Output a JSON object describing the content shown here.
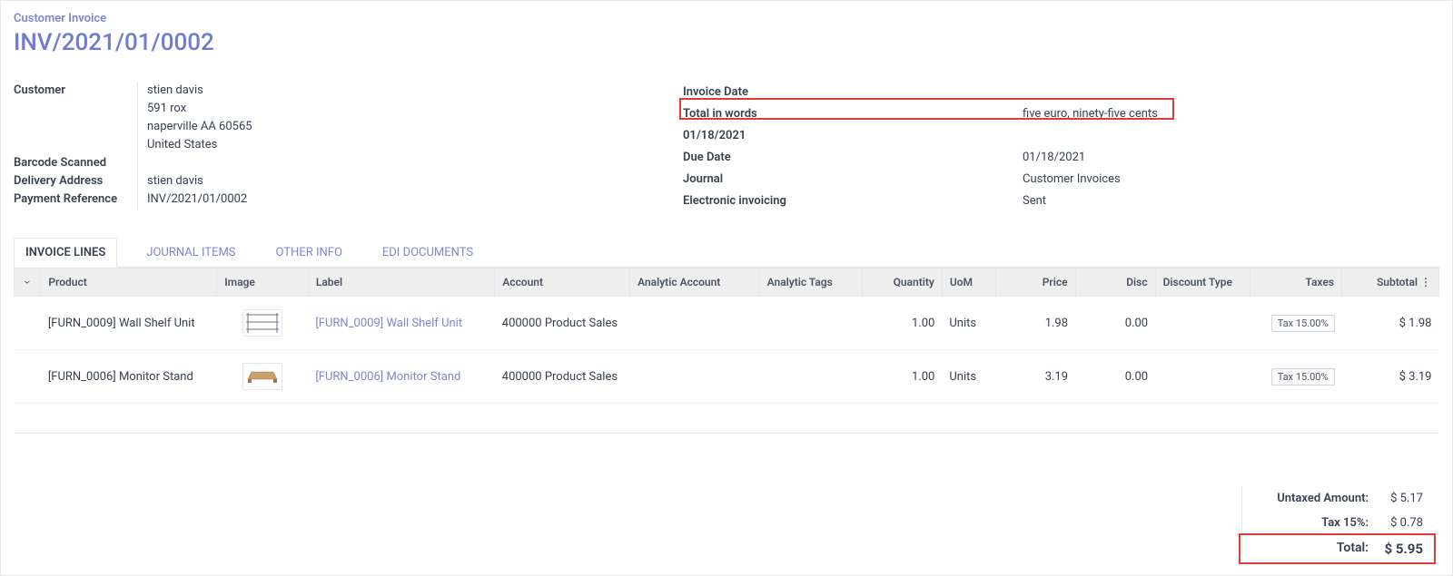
{
  "header": {
    "breadcrumb": "Customer Invoice",
    "invoice_number": "INV/2021/01/0002"
  },
  "customer_block": {
    "label_customer": "Customer",
    "label_barcode": "Barcode Scanned",
    "label_delivery": "Delivery Address",
    "label_paymentref": "Payment Reference",
    "name": "stien davis",
    "street": "591 rox",
    "city": "naperville AA 60565",
    "country": "United States",
    "delivery_name": "stien davis",
    "paymentref": "INV/2021/01/0002"
  },
  "meta": {
    "label_invoice_date": "Invoice Date",
    "label_total_words": "Total in words",
    "total_words": "five euro, ninety-five cents",
    "invoice_date": "01/18/2021",
    "label_due_date": "Due Date",
    "due_date": "01/18/2021",
    "label_journal": "Journal",
    "journal": "Customer Invoices",
    "label_einvoicing": "Electronic invoicing",
    "einvoicing": "Sent"
  },
  "tabs": {
    "invoice_lines": "INVOICE LINES",
    "journal_items": "JOURNAL ITEMS",
    "other_info": "OTHER INFO",
    "edi_docs": "EDI DOCUMENTS"
  },
  "table": {
    "headers": {
      "product": "Product",
      "image": "Image",
      "label": "Label",
      "account": "Account",
      "analytic_account": "Analytic Account",
      "analytic_tags": "Analytic Tags",
      "quantity": "Quantity",
      "uom": "UoM",
      "price": "Price",
      "disc": "Disc",
      "disc_type": "Discount Type",
      "taxes": "Taxes",
      "subtotal": "Subtotal"
    },
    "rows": [
      {
        "product": "[FURN_0009] Wall Shelf Unit",
        "label": "[FURN_0009] Wall Shelf Unit",
        "account": "400000 Product Sales",
        "quantity": "1.00",
        "uom": "Units",
        "price": "1.98",
        "disc": "0.00",
        "taxes": "Tax 15.00%",
        "subtotal": "$ 1.98"
      },
      {
        "product": "[FURN_0006] Monitor Stand",
        "label": "[FURN_0006] Monitor Stand",
        "account": "400000 Product Sales",
        "quantity": "1.00",
        "uom": "Units",
        "price": "3.19",
        "disc": "0.00",
        "taxes": "Tax 15.00%",
        "subtotal": "$ 3.19"
      }
    ]
  },
  "totals": {
    "label_untaxed": "Untaxed Amount:",
    "untaxed": "$ 5.17",
    "label_tax": "Tax 15%:",
    "tax": "$ 0.78",
    "label_total": "Total:",
    "total": "$ 5.95"
  }
}
